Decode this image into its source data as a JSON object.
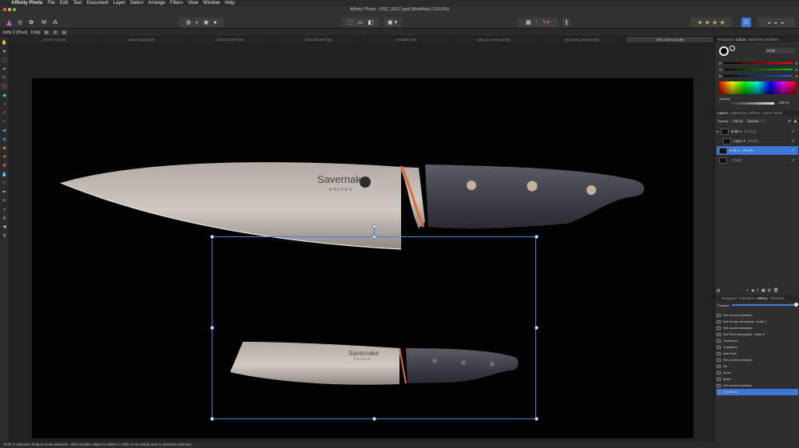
{
  "menubar": {
    "app_name": "Affinity Photo",
    "items": [
      "File",
      "Edit",
      "Text",
      "Document",
      "Layer",
      "Select",
      "Arrange",
      "Filters",
      "View",
      "Window",
      "Help"
    ]
  },
  "window": {
    "title": "Affinity Photo - DSC_8167.psd (Modified) (110.0%)"
  },
  "context": {
    "layer_info": "knife 2 (Pixel)",
    "dpi": "16dpi"
  },
  "tabs": [
    {
      "label": "_DSC8773.tif [M]"
    },
    {
      "label": "sunset_at.psd [M]"
    },
    {
      "label": "_DSC0333.NEF [M]"
    },
    {
      "label": "_DSC0333.NEF [M]"
    },
    {
      "label": "TEA60587 [M]"
    },
    {
      "label": "split_at_curves.psd [M]"
    },
    {
      "label": "fqr4_fetal_palet.psd [M]"
    },
    {
      "label": "DSC_8167.psd [M]"
    }
  ],
  "tools": [
    "move-icon",
    "select-icon",
    "crop-icon",
    "brush-icon",
    "paint-icon",
    "flood-icon",
    "gradient-icon",
    "eraser-icon",
    "clone-icon",
    "dodge-icon",
    "smudge-icon",
    "pen-icon",
    "shape-icon",
    "text-icon",
    "hand-icon",
    "zoom-icon"
  ],
  "canvas": {
    "brand_large": "Savernake",
    "brand_large_sub": "KNIVES",
    "brand_small": "Savernake",
    "brand_small_sub": "KNIVES"
  },
  "colour_panel": {
    "tabs": [
      "Histogram",
      "Colour",
      "Swatches",
      "Brushes"
    ],
    "active_tab": "Colour",
    "model": "RGB",
    "r": "0",
    "g": "0",
    "b": "0",
    "opacity_label": "Opacity",
    "opacity_value": "100 %"
  },
  "layers_panel": {
    "tabs": [
      "Layers",
      "Adjustment",
      "Effects",
      "Styles",
      "Stock"
    ],
    "active_tab": "Layers",
    "opacity_label": "Opacity:",
    "opacity_value": "100 %",
    "blend_mode": "Normal",
    "layers": [
      {
        "name": "knife 1",
        "type": "(Group)",
        "selected": false
      },
      {
        "name": "Layer 2",
        "type": "(Pixel)",
        "selected": false
      },
      {
        "name": "knife 2",
        "type": "(Pixel)",
        "selected": true
      },
      {
        "name": "",
        "type": "(Pixel)",
        "selected": false
      }
    ]
  },
  "history_panel": {
    "tabs": [
      "Navigator",
      "Transform",
      "History",
      "Channels"
    ],
    "active_tab": "History",
    "position_label": "Position:",
    "items": [
      "Set current selection",
      "Set Group description: \"knife 1\"",
      "Set current selection",
      "Set Pixel description: \"knife 2\"",
      "Transform",
      "Transform",
      "Add Pixel",
      "Set current selection",
      "Fill",
      "Move",
      "Move",
      "Set current selection",
      "Transform"
    ],
    "selected_index": 12
  },
  "status": {
    "text": "'knife 2' selected. Drag to move selection. Click another object to select it. Click on an empty area to deselect selection."
  },
  "colors": {
    "accent": "#3b78d8",
    "selection": "#4a7fd6"
  }
}
